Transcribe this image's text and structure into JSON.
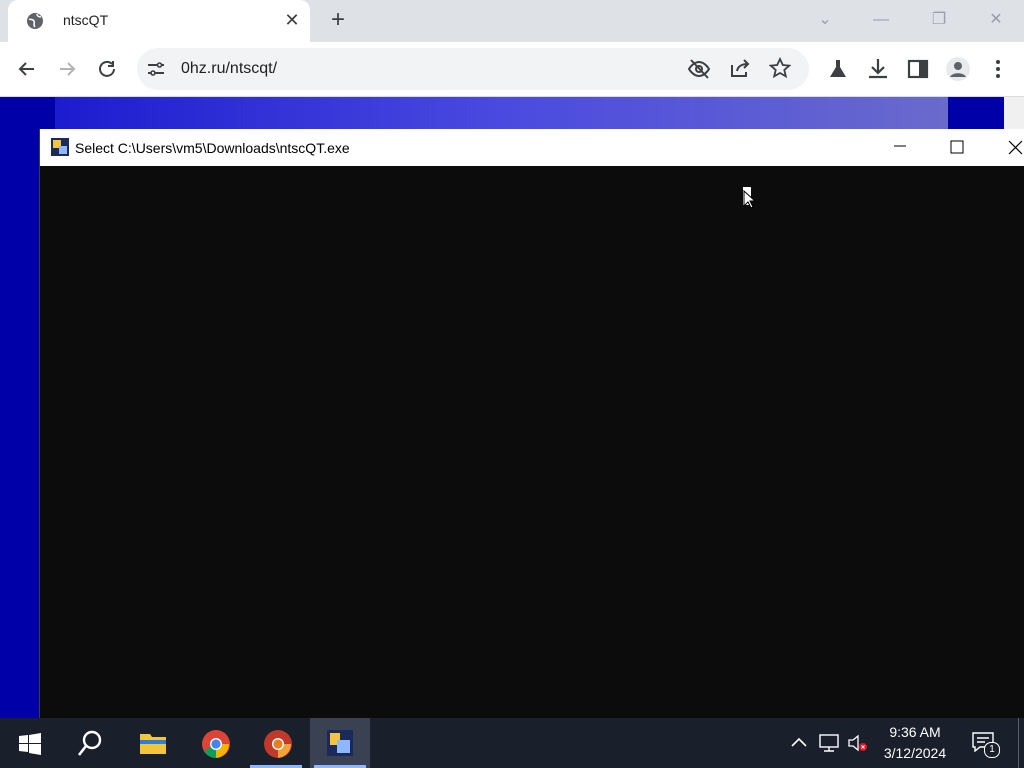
{
  "browser": {
    "tab_title": "ntscQT",
    "url": "0hz.ru/ntscqt/"
  },
  "console": {
    "title": "Select C:\\Users\\vm5\\Downloads\\ntscQT.exe"
  },
  "taskbar": {
    "time": "9:36 AM",
    "date": "3/12/2024",
    "notifications": "1"
  },
  "icons": [
    "globe-icon",
    "close-icon",
    "plus-icon",
    "back-icon",
    "forward-icon",
    "reload-icon",
    "site-settings-icon",
    "eye-off-icon",
    "share-icon",
    "star-icon",
    "labs-icon",
    "download-icon",
    "sidepanel-icon",
    "profile-icon",
    "menu-icon",
    "console-app-icon",
    "minimize-icon",
    "maximize-icon",
    "windows-start-icon",
    "search-icon",
    "file-explorer-icon",
    "chrome-icon",
    "chrome-canary-icon",
    "ntscqt-icon",
    "chevron-up-icon",
    "network-icon",
    "volume-muted-icon",
    "action-center-icon"
  ],
  "colors": {
    "console_bg": "#0c0c0c",
    "taskbar_bg": "#1a1f2c",
    "page_bg": "#0000a8"
  }
}
